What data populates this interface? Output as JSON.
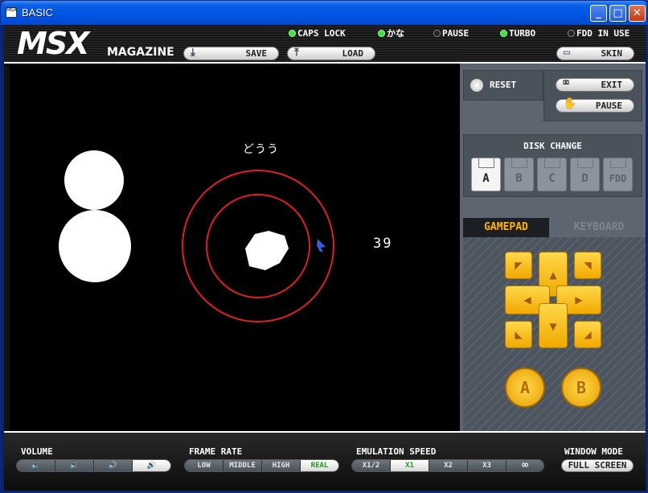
{
  "window": {
    "title": "BASIC",
    "icon_text": "MSX",
    "minimize": "_",
    "maximize": "□",
    "close": "✕"
  },
  "header": {
    "logo": "MSX",
    "logo_sub": "MAGAZINE",
    "indicators": [
      {
        "label": "CAPS LOCK",
        "on": true
      },
      {
        "label": "かな",
        "on": true
      },
      {
        "label": "PAUSE",
        "on": false
      },
      {
        "label": "TURBO",
        "on": true
      },
      {
        "label": "FDD IN USE",
        "on": false
      }
    ],
    "save_label": "SAVE",
    "load_label": "LOAD",
    "skin_label": "SKIN"
  },
  "screen": {
    "word": "どうう",
    "number": "39"
  },
  "controls": {
    "reset_label": "RESET",
    "exit_label": "EXIT",
    "pause_label": "PAUSE",
    "disk_title": "DISK CHANGE",
    "disks": [
      "A",
      "B",
      "C",
      "D",
      "FDD"
    ],
    "selected_disk": "A"
  },
  "tabs": {
    "gamepad": "GAMEPAD",
    "keyboard": "KEYBOARD",
    "active": "GAMEPAD"
  },
  "gamepad": {
    "a_label": "A",
    "b_label": "B"
  },
  "bottom": {
    "volume_label": "VOLUME",
    "frame_rate_label": "FRAME RATE",
    "frame_rates": [
      "LOW",
      "MIDDLE",
      "HIGH",
      "REAL"
    ],
    "frame_rate_selected": "REAL",
    "speed_label": "EMULATION SPEED",
    "speeds": [
      "X1/2",
      "X1",
      "X2",
      "X3",
      "∞"
    ],
    "speed_selected": "X1",
    "window_mode_label": "WINDOW MODE",
    "fullscreen_label": "FULL SCREEN"
  },
  "colors": {
    "accent": "#ffb400",
    "indicator_on": "#3fe03f",
    "ring": "#e0201e"
  }
}
